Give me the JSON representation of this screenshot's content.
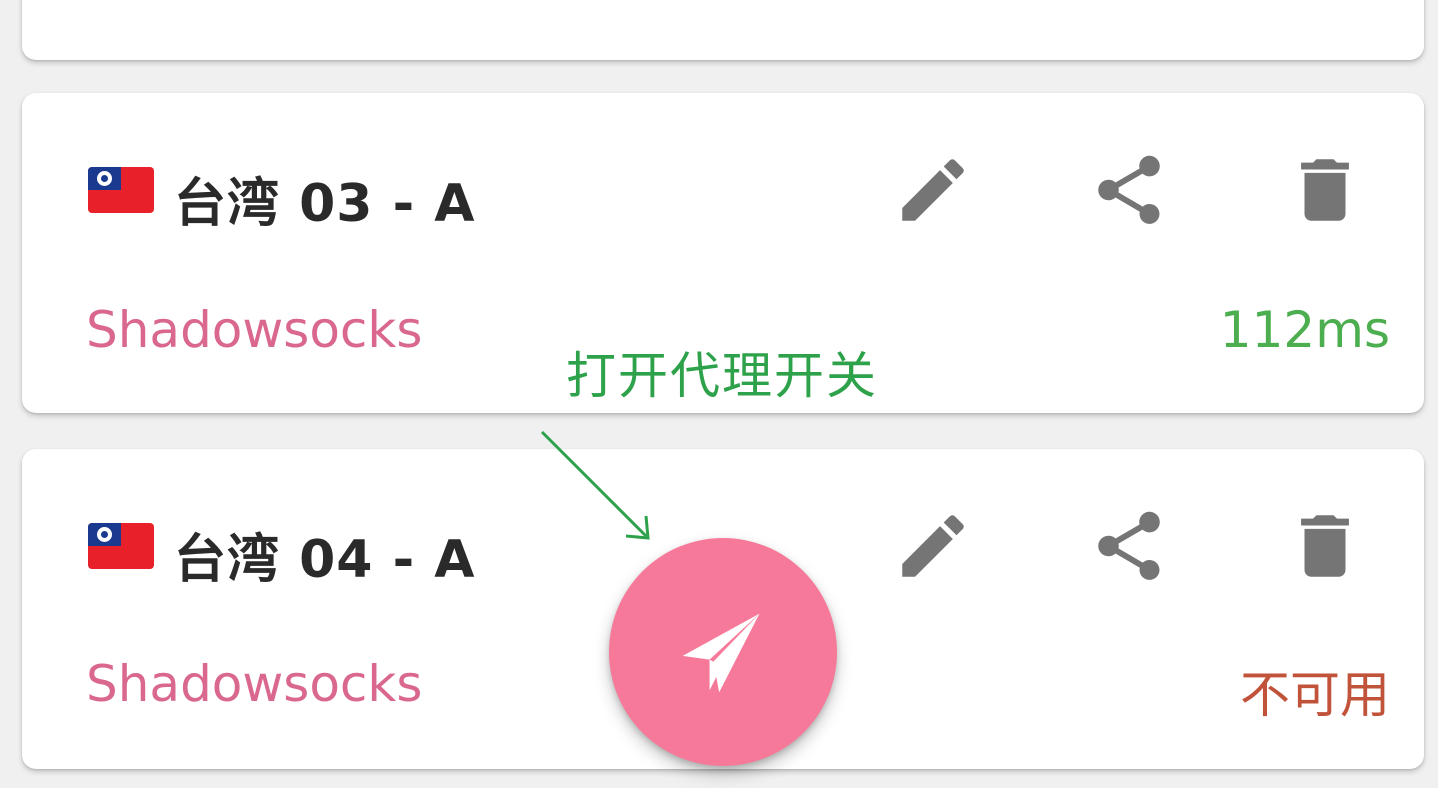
{
  "annotation": {
    "text": "打开代理开关",
    "color": "#2ea24a"
  },
  "servers": [
    {
      "name": "台湾 03 - A",
      "flag": "taiwan-flag-icon",
      "protocol": "Shadowsocks",
      "latency": "112ms",
      "latency_color": "#4cae4f"
    },
    {
      "name": "台湾 04 - A",
      "flag": "taiwan-flag-icon",
      "protocol": "Shadowsocks",
      "latency": "不可用",
      "latency_color": "#c0533a"
    }
  ],
  "actions": {
    "edit_icon": "pencil-icon",
    "share_icon": "share-icon",
    "delete_icon": "trash-icon"
  },
  "fab": {
    "icon": "paper-plane-icon",
    "color": "#f7799a"
  },
  "colors": {
    "protocol": "#d9678e",
    "icon": "#757575"
  }
}
